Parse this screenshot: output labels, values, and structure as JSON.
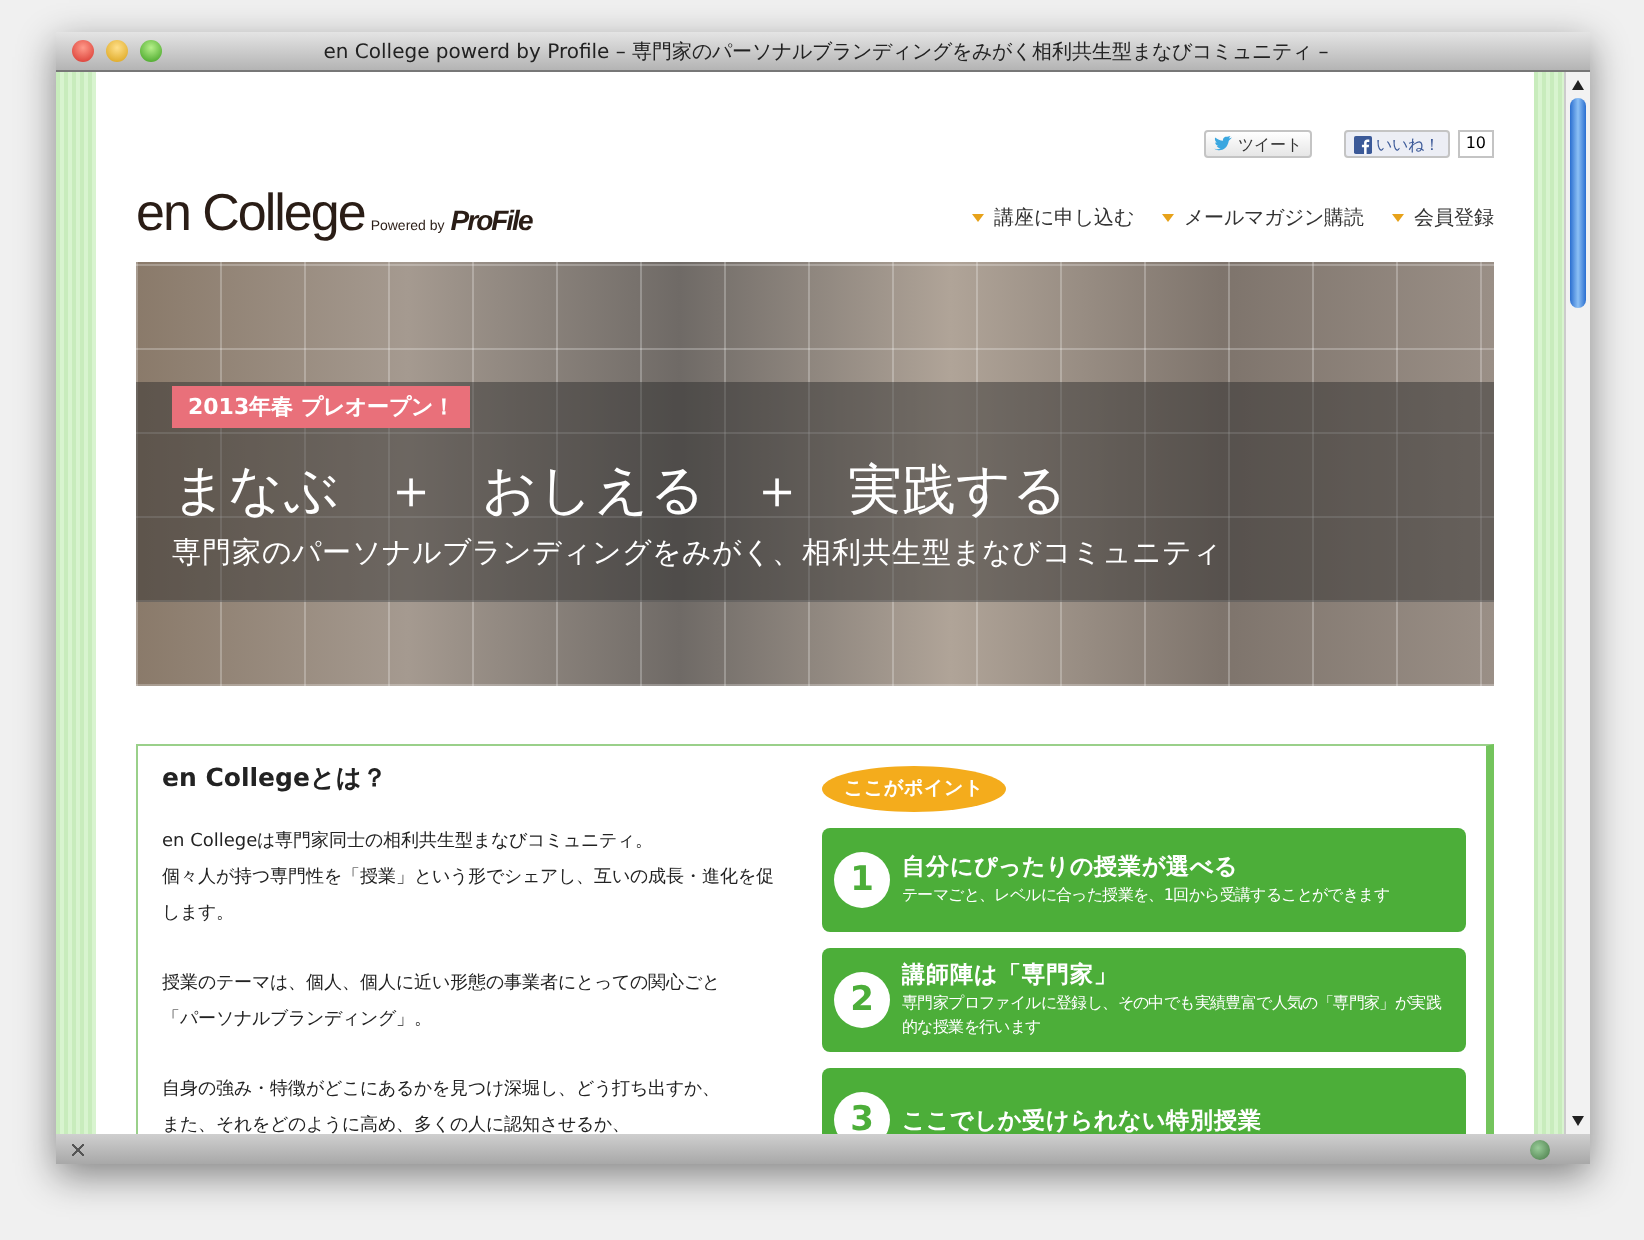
{
  "window": {
    "title": "en College powerd by Profile – 専門家のパーソナルブランディングをみがく相利共生型まなびコミュニティ –"
  },
  "social": {
    "tweet": "ツイート",
    "like": "いいね！",
    "like_count": "10"
  },
  "logo": {
    "name": "en College",
    "powered": "Powered by",
    "brand": "ProFile"
  },
  "nav": [
    "講座に申し込む",
    "メールマガジン購読",
    "会員登録"
  ],
  "hero": {
    "badge": "2013年春 プレオープン！",
    "headline": [
      "まなぶ",
      "＋",
      "おしえる",
      "＋",
      "実践する"
    ],
    "subline": "専門家のパーソナルブランディングをみがく、相利共生型まなびコミュニティ"
  },
  "about": {
    "title": "en Collegeとは？",
    "paragraphs": [
      [
        "en Collegeは専門家同士の相利共生型まなびコミュニティ。",
        "個々人が持つ専門性を「授業」という形でシェアし、互いの成長・進化を促します。"
      ],
      [
        "授業のテーマは、個人、個人に近い形態の事業者にとっての関心ごと",
        "「パーソナルブランディング」。"
      ],
      [
        "自身の強み・特徴がどこにあるかを見つけ深堀し、どう打ち出すか、",
        "また、それをどのように高め、多くの人に認知させるか、"
      ]
    ]
  },
  "points": {
    "label": "ここがポイント",
    "items": [
      {
        "number": "1",
        "title": "自分にぴったりの授業が選べる",
        "description": "テーマごと、レベルに合った授業を、1回から受講することができます"
      },
      {
        "number": "2",
        "title": "講師陣は「専門家」",
        "description": "専門家プロファイルに登録し、その中でも実績豊富で人気の「専門家」が実践的な授業を行います"
      },
      {
        "number": "3",
        "title": "ここでしか受けられない特別授業"
      }
    ]
  }
}
